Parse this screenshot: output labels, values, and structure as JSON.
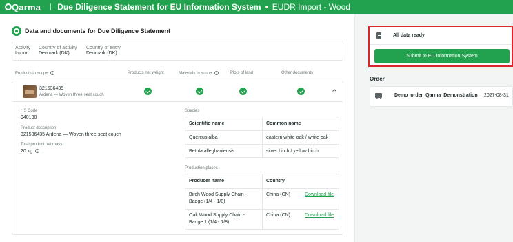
{
  "header": {
    "logo": "Qarma",
    "title": "Due Diligence Statement for EU Information System",
    "separator": "•",
    "subtitle": "EUDR Import - Wood"
  },
  "section": {
    "title": "Data and documents for Due Diligence Statement"
  },
  "activity": {
    "activity_label": "Activity",
    "activity_value": "Import",
    "country_activity_label": "Country of activity",
    "country_activity_value": "Denmark (DK)",
    "country_entry_label": "Country of entry",
    "country_entry_value": "Denmark (DK)"
  },
  "products_table": {
    "headers": {
      "products_in_scope": "Products in scope",
      "net_weight": "Products net weight",
      "materials": "Materials in scope",
      "plots": "Plots of land",
      "other_docs": "Other documents"
    },
    "product": {
      "id": "321536435",
      "subtitle": "Ardena — Woven three-seat couch"
    }
  },
  "details": {
    "hs_code_label": "HS Code",
    "hs_code_value": "940180",
    "description_label": "Product description",
    "description_value": "321536435 Ardena — Woven three-seat couch",
    "mass_label": "Total product net mass",
    "mass_value": "20 kg"
  },
  "species": {
    "title": "Species",
    "headers": [
      "Scientific name",
      "Common name"
    ],
    "rows": [
      [
        "Quercus alba",
        "eastern white oak / white oak"
      ],
      [
        "Betula alleghaniensis",
        "silver birch / yellow birch"
      ]
    ]
  },
  "production": {
    "title": "Production places",
    "headers": [
      "Producer name",
      "Country"
    ],
    "rows": [
      {
        "producer_l1": "Birch Wood Supply Chain -",
        "producer_l2": "Badge (1/4 - 1/8)",
        "country": "China (CN)",
        "link": "Download file"
      },
      {
        "producer_l1": "Oak Wood Supply Chain -",
        "producer_l2": "Badge 1 (1/4 - 1/8)",
        "country": "China (CN)",
        "link": "Download file"
      }
    ]
  },
  "right_panel": {
    "status": "All data ready",
    "submit_label": "Submit to EU Information System",
    "order_title": "Order",
    "order_name": "Demo_order_Qarma_Demonstration",
    "order_date": "2027-08-31"
  },
  "colors": {
    "brand_green": "#22a24f",
    "highlight_red": "#d9262b"
  },
  "icons": [
    "info-icon",
    "check-icon",
    "chevron-up-icon",
    "document-icon",
    "truck-icon"
  ]
}
